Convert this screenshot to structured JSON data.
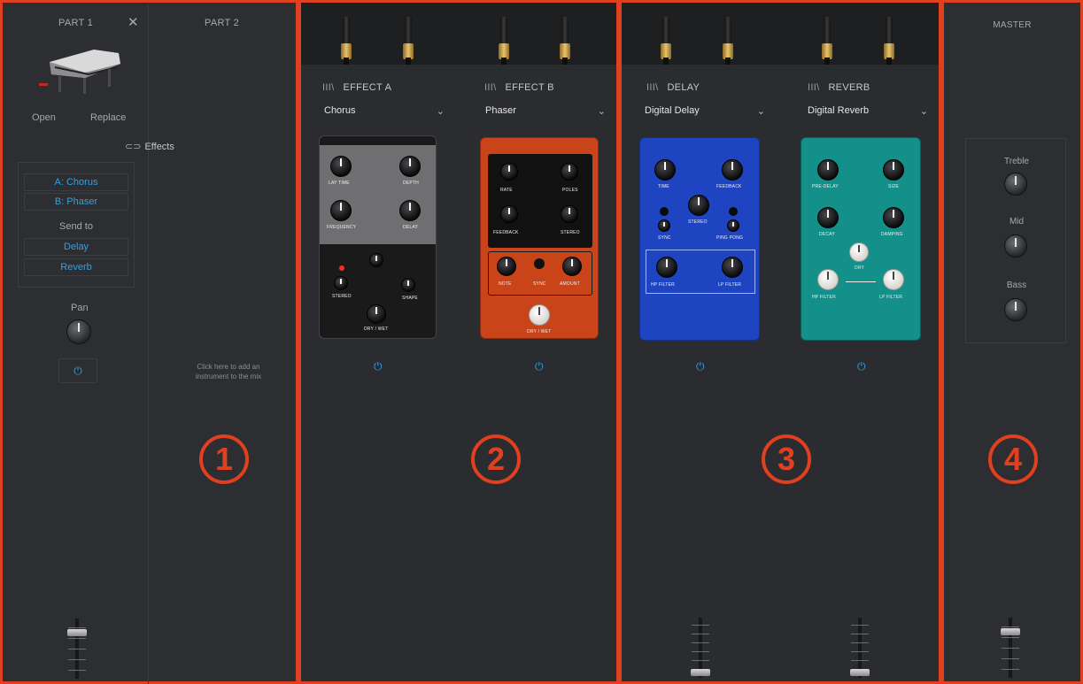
{
  "part1": {
    "title": "PART 1",
    "close_label": "✕",
    "open_label": "Open",
    "replace_label": "Replace",
    "effects_label": "Effects",
    "effects_arrow": "⊂⊃",
    "fx_a": "A: Chorus",
    "fx_b": "B: Phaser",
    "send_to_label": "Send to",
    "send_delay": "Delay",
    "send_reverb": "Reverb",
    "pan_label": "Pan",
    "power_icon": "⏻"
  },
  "part2": {
    "title": "PART 2",
    "hint": "Click here to add an instrument to the mix"
  },
  "effects": {
    "slot_bars": "III\\",
    "effect_a": {
      "title": "EFFECT A",
      "selected": "Chorus"
    },
    "effect_b": {
      "title": "EFFECT B",
      "selected": "Phaser"
    },
    "delay": {
      "title": "DELAY",
      "selected": "Digital Delay"
    },
    "reverb": {
      "title": "REVERB",
      "selected": "Digital Reverb"
    },
    "chevron": "⌄",
    "power_icon": "⏻"
  },
  "pedals": {
    "chorus": {
      "k1": "LAY TIME",
      "k2": "DEPTH",
      "k3": "FREQUENCY",
      "k4": "DELAY",
      "stereo": "STEREO",
      "shape": "SHAPE",
      "drywet": "DRY / WET",
      "color": "#6f6f72"
    },
    "phaser": {
      "k1": "RATE",
      "k2": "POLES",
      "k3": "FEEDBACK",
      "k4": "STEREO",
      "k5": "NOTE",
      "k6": "SYNC",
      "k7": "AMOUNT",
      "k8": "DRY / WET",
      "color": "#c94418"
    },
    "delay": {
      "k1": "TIME",
      "k2": "FEEDBACK",
      "k3": "STEREO",
      "k4": "SYNC",
      "k5": "PING PONG",
      "k6": "HP FILTER",
      "k7": "LP FILTER",
      "color": "#1f44c2"
    },
    "reverb": {
      "k1": "PRE-DELAY",
      "k2": "SIZE",
      "k3": "DECAY",
      "k4": "DAMPING",
      "k5": "DRY",
      "k6": "HP FILTER",
      "k7": "LP FILTER",
      "color": "#14908a"
    }
  },
  "master": {
    "title": "MASTER",
    "treble_label": "Treble",
    "mid_label": "Mid",
    "bass_label": "Bass"
  },
  "zones": {
    "z1": "1",
    "z2": "2",
    "z3": "3",
    "z4": "4"
  }
}
